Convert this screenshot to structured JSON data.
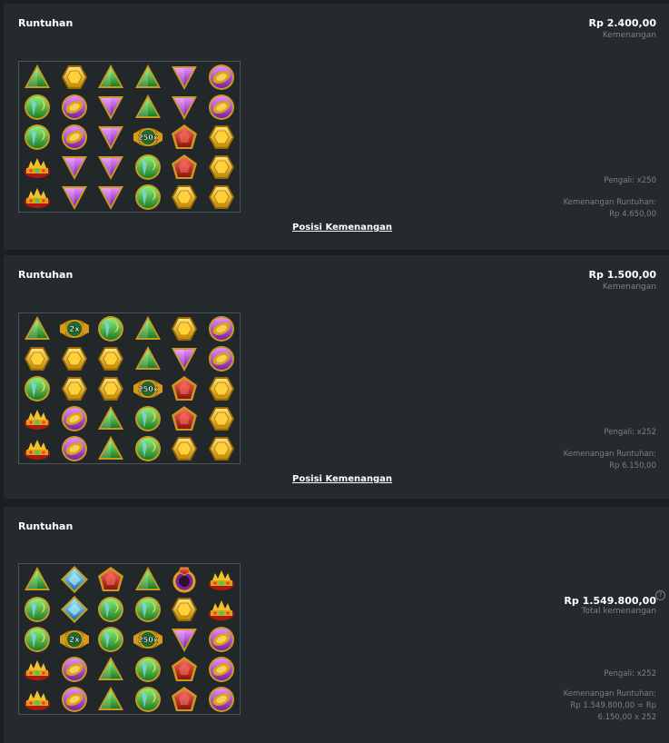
{
  "panels": [
    {
      "title": "Runtuhan",
      "win_amount": "Rp 2.400,00",
      "win_label": "Kemenangan",
      "multiplier": "Pengali: x250",
      "cascade_label": "Kemenangan Runtuhan:",
      "cascade_value": "Rp 4.650,00",
      "link": "Posisi Kemenangan",
      "grid": [
        [
          "green-triangle",
          "gold-hexagon",
          "green-triangle",
          "green-triangle",
          "purple-triangle",
          "purple-scarab"
        ],
        [
          "green-scarab",
          "purple-scarab",
          "purple-triangle",
          "green-triangle",
          "purple-triangle",
          "purple-scarab"
        ],
        [
          "green-scarab",
          "purple-scarab",
          "purple-triangle",
          "multiplier-250",
          "red-pentagon",
          "gold-hexagon"
        ],
        [
          "red-crown",
          "purple-triangle",
          "purple-triangle",
          "green-scarab",
          "red-pentagon",
          "gold-hexagon"
        ],
        [
          "red-crown",
          "purple-triangle",
          "purple-triangle",
          "green-scarab",
          "gold-hexagon",
          "gold-hexagon"
        ]
      ]
    },
    {
      "title": "Runtuhan",
      "win_amount": "Rp 1.500,00",
      "win_label": "Kemenangan",
      "multiplier": "Pengali: x252",
      "cascade_label": "Kemenangan Runtuhan:",
      "cascade_value": "Rp 6.150,00",
      "link": "Posisi Kemenangan",
      "grid": [
        [
          "green-triangle",
          "multiplier-2",
          "green-scarab",
          "green-triangle",
          "gold-hexagon",
          "purple-scarab"
        ],
        [
          "gold-hexagon",
          "gold-hexagon",
          "gold-hexagon",
          "green-triangle",
          "purple-triangle",
          "purple-scarab"
        ],
        [
          "green-scarab",
          "gold-hexagon",
          "gold-hexagon",
          "multiplier-250",
          "red-pentagon",
          "gold-hexagon"
        ],
        [
          "red-crown",
          "purple-scarab",
          "green-triangle",
          "green-scarab",
          "red-pentagon",
          "gold-hexagon"
        ],
        [
          "red-crown",
          "purple-scarab",
          "green-triangle",
          "green-scarab",
          "gold-hexagon",
          "gold-hexagon"
        ]
      ]
    },
    {
      "title": "Runtuhan",
      "total_amount": "Rp 1.549.800,00",
      "total_label": "Total kemenangan",
      "help_symbol": "?",
      "multiplier": "Pengali: x252",
      "cascade_label": "Kemenangan Runtuhan:",
      "cascade_formula_1": "Rp 1.549.800,00 = Rp",
      "cascade_formula_2": "6.150,00 x 252",
      "grid": [
        [
          "green-triangle",
          "blue-diamond",
          "red-pentagon",
          "green-triangle",
          "red-ring",
          "red-crown"
        ],
        [
          "green-scarab",
          "blue-diamond",
          "green-scarab",
          "green-scarab",
          "gold-hexagon",
          "red-crown"
        ],
        [
          "green-scarab",
          "multiplier-2",
          "green-scarab",
          "multiplier-250",
          "purple-triangle",
          "purple-scarab"
        ],
        [
          "red-crown",
          "purple-scarab",
          "green-triangle",
          "green-scarab",
          "red-pentagon",
          "purple-scarab"
        ],
        [
          "red-crown",
          "purple-scarab",
          "green-triangle",
          "green-scarab",
          "red-pentagon",
          "purple-scarab"
        ]
      ]
    }
  ],
  "multiplier_labels": {
    "multiplier-2": "2x",
    "multiplier-250": "250x"
  },
  "colors": {
    "panel_bg": "#242a2d",
    "page_bg": "#1b1f22",
    "muted_text": "#7a8186",
    "gold": "#f2b90c",
    "green": "#2fae3a",
    "purple": "#b43ed8",
    "red": "#d0281f",
    "blue": "#2bb6e6"
  }
}
